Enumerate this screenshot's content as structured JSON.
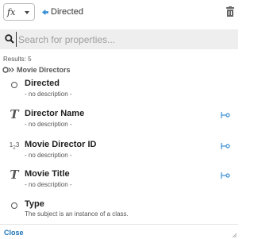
{
  "toolbar": {
    "function_icon_label": "fx",
    "back_label": "Directed"
  },
  "search": {
    "placeholder": "Search for properties..."
  },
  "results": {
    "count_text": "Results: 5",
    "class_name": "Movie Directors"
  },
  "properties": [
    {
      "name": "Directed",
      "description": "- no description -",
      "icon": "circle-icon",
      "has_action": false
    },
    {
      "name": "Director Name",
      "description": "- no description -",
      "icon": "text-type-icon",
      "has_action": true
    },
    {
      "name": "Movie Director ID",
      "description": "- no description -",
      "icon": "numeric-type-icon",
      "has_action": true
    },
    {
      "name": "Movie Title",
      "description": "- no description -",
      "icon": "text-type-icon",
      "has_action": true
    },
    {
      "name": "Type",
      "description": "The subject is an instance of a class.",
      "icon": "circle-icon",
      "has_action": false
    }
  ],
  "footer": {
    "close_label": "Close"
  },
  "colors": {
    "accent": "#1a73b8",
    "search_bg": "#eeeeee"
  }
}
